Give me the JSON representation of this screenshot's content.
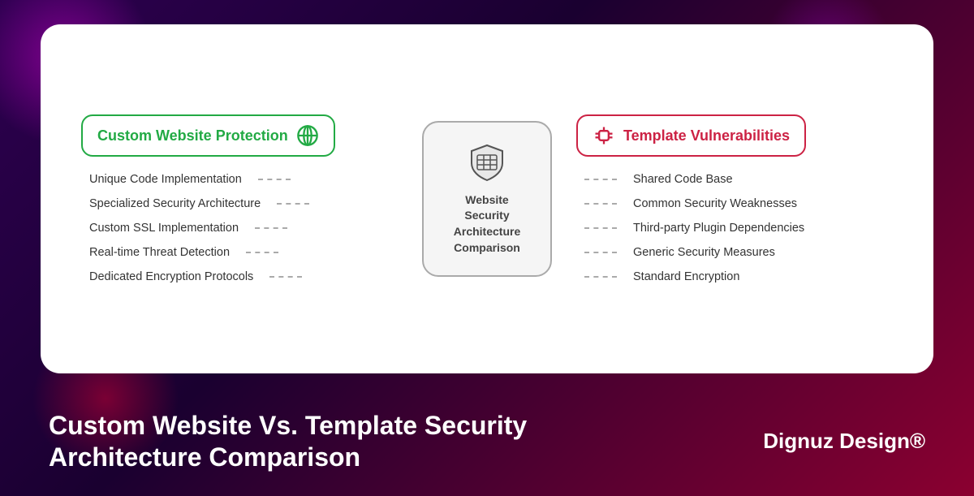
{
  "background": {
    "color": "#1a0030"
  },
  "card": {
    "left": {
      "badge_text": "Custom Website Protection",
      "items": [
        "Unique Code Implementation",
        "Specialized Security Architecture",
        "Custom SSL Implementation",
        "Real-time Threat Detection",
        "Dedicated Encryption Protocols"
      ]
    },
    "center": {
      "title": "Website\nSecurity\nArchitecture\nComparison"
    },
    "right": {
      "badge_text": "Template Vulnerabilities",
      "items": [
        "Shared Code Base",
        "Common Security Weaknesses",
        "Third-party Plugin Dependencies",
        "Generic Security Measures",
        "Standard Encryption"
      ]
    }
  },
  "footer": {
    "title": "Custom Website Vs. Template Security\nArchitecture Comparison",
    "brand": "Dignuz Design®"
  }
}
